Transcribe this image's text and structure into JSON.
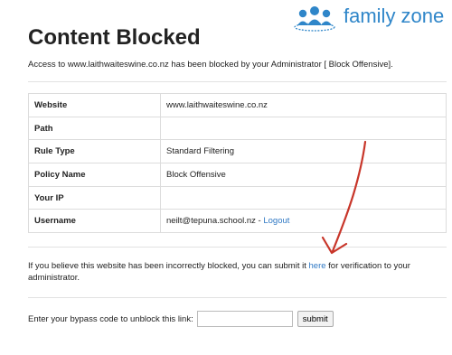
{
  "brand": {
    "logo_text": "family zone"
  },
  "page": {
    "title": "Content Blocked",
    "notice": "Access to www.laithwaiteswine.co.nz has been blocked by your Administrator [ Block Offensive]."
  },
  "details": {
    "rows": [
      {
        "label": "Website",
        "value": "www.laithwaiteswine.co.nz"
      },
      {
        "label": "Path",
        "value": ""
      },
      {
        "label": "Rule Type",
        "value": "Standard Filtering"
      },
      {
        "label": "Policy Name",
        "value": "Block Offensive"
      },
      {
        "label": "Your IP",
        "value": ""
      },
      {
        "label": "Username",
        "value": "neilt@tepuna.school.nz",
        "separator": " - ",
        "link": "Logout"
      }
    ]
  },
  "verification": {
    "text_before": "If you believe this website has been incorrectly blocked, you can submit it ",
    "link": "here",
    "text_after": " for verification to your administrator."
  },
  "bypass": {
    "label": "Enter your bypass code to unblock this link:",
    "input_value": "",
    "submit_label": "submit"
  },
  "colors": {
    "brand_blue": "#2f86c9",
    "link_blue": "#2f78c4",
    "annotation_red": "#c8362a"
  }
}
